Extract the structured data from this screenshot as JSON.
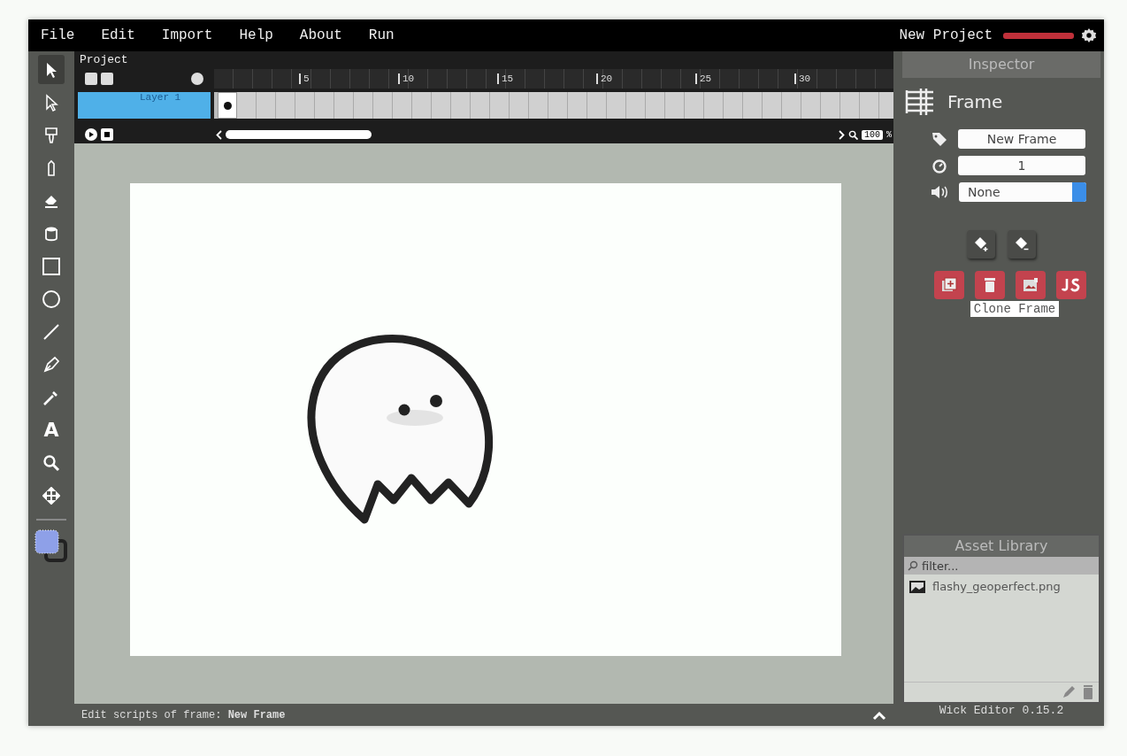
{
  "menu": [
    "File",
    "Edit",
    "Import",
    "Help",
    "About",
    "Run"
  ],
  "project": {
    "title": "New Project",
    "unsaved": true
  },
  "tools": [
    {
      "kind": "select",
      "selected": true
    },
    {
      "kind": "path",
      "selected": false
    },
    {
      "kind": "fill",
      "selected": false
    },
    {
      "kind": "pencil",
      "selected": false
    },
    {
      "kind": "eraser",
      "selected": false
    },
    {
      "kind": "bucket",
      "selected": false
    },
    {
      "kind": "rect",
      "selected": false
    },
    {
      "kind": "ellipse",
      "selected": false
    },
    {
      "kind": "line",
      "selected": false
    },
    {
      "kind": "pen",
      "selected": false
    },
    {
      "kind": "dropper",
      "selected": false
    },
    {
      "kind": "text",
      "selected": false,
      "label": "A"
    },
    {
      "kind": "zoom",
      "selected": false
    },
    {
      "kind": "pan",
      "selected": false
    }
  ],
  "timeline": {
    "label": "Project",
    "ticks": [
      "5",
      "10",
      "15",
      "20",
      "25",
      "30"
    ],
    "layers": [
      {
        "name": "Layer 1",
        "selected": true
      }
    ],
    "zoom": "100",
    "zoom_unit": "%"
  },
  "inspector": {
    "title": "Inspector",
    "heading": "Frame",
    "name_value": "New Frame",
    "duration_value": "1",
    "sound_value": "None",
    "tooltip": "Clone Frame"
  },
  "assets": {
    "title": "Asset Library",
    "placeholder": "filter...",
    "items": [
      "flashy_geoperfect.png"
    ]
  },
  "status": "Edit scripts of frame: **New Frame**",
  "version": "Wick Editor 0.15.2"
}
